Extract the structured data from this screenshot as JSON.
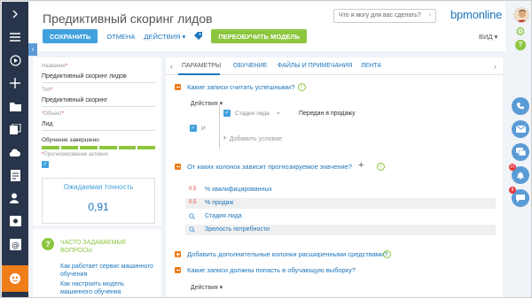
{
  "page": {
    "title": "Предиктивный скоринг лидов",
    "help_placeholder": "Что я могу для вас сделать?",
    "logo": "bpmonline"
  },
  "toolbar": {
    "save_label": "СОХРАНИТЬ",
    "cancel_label": "ОТМЕНА",
    "actions_label": "ДЕЙСТВИЯ ▾",
    "retrain_label": "ПЕРЕОБУЧИТЬ МОДЕЛЬ",
    "view_label": "ВИД ▾"
  },
  "record": {
    "name_label": "Название",
    "name_value": "Предиктивный скоринг лидов",
    "type_label": "Тип",
    "type_value": "Предиктивный скоринг",
    "object_label": "Объект",
    "object_value": "Лид",
    "training_status_label": "Обучение завершено",
    "training_progress": 1.0,
    "forecast_label": "Прогнозирование активно",
    "forecast_enabled": true,
    "accuracy_label": "Ожидаемая точность",
    "accuracy_value": "0,91"
  },
  "faq": {
    "title": "ЧАСТО ЗАДАВАЕМЫЕ ВОПРОСЫ",
    "links": [
      "Как работает сервис машинного обучения",
      "Как настроить модель машинного обучения"
    ]
  },
  "tabs": [
    {
      "label": "ПАРАМЕТРЫ",
      "active": true
    },
    {
      "label": "ОБУЧЕНИЕ",
      "active": false
    },
    {
      "label": "ФАЙЛЫ И ПРИМЕЧАНИЯ",
      "active": false
    },
    {
      "label": "ЛЕНТА",
      "active": false
    }
  ],
  "sections": {
    "success": {
      "title": "Какие записи считать успешными?",
      "actions_label": "Действия ▾",
      "logic_label": "И",
      "condition_field": "Стадия лида",
      "condition_op": "=",
      "condition_value": "Передан в продажу",
      "add_condition_label": "Добавить условие"
    },
    "columns": {
      "title": "От каких колонок зависит прогнозируемое значение?",
      "items": [
        {
          "prefix": "0.5",
          "label": "% квалифицированных"
        },
        {
          "prefix": "0.5",
          "label": "% продаж"
        },
        {
          "prefix": "Q",
          "label": "Стадия лида"
        },
        {
          "prefix": "Q",
          "label": "Зрелость потребности"
        }
      ]
    },
    "advanced": {
      "title": "Добавить дополнительные колонки расширенными средствами?"
    },
    "training": {
      "title": "Какие записи должны попасть в обучающую выборку?",
      "actions_label": "Действия ▾"
    }
  },
  "notifications": {
    "feed_badge": "37",
    "chat_badge": "8"
  },
  "colors": {
    "sidebar": "#273449",
    "accent_orange": "#ef7d1a",
    "primary_blue": "#41a1dd",
    "link_blue": "#1c75bc",
    "green": "#8cc63f"
  }
}
